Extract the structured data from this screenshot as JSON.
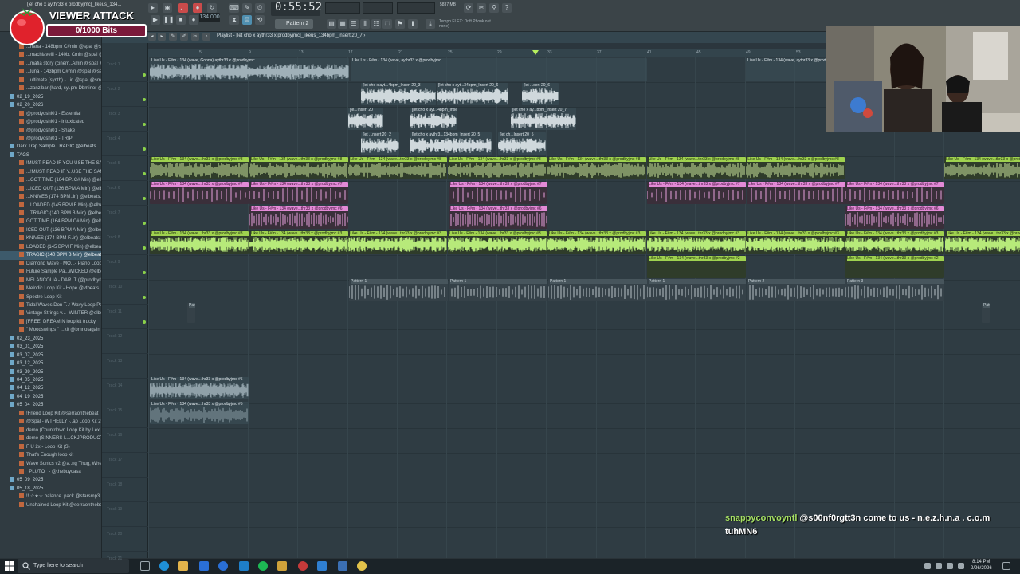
{
  "window": {
    "title": "[let cho x aythr33 x prodbyjmc]_likeus_134..."
  },
  "overlay": {
    "title": "VIEWER ATTACK",
    "bits": "0/1000 Bits"
  },
  "transport": {
    "tempo": "134.000",
    "time": "0:55:52",
    "pattern": "Pattern 2",
    "memory": "5837 MB",
    "hint_line1": "Tempo FLEX: Drift Phonk out",
    "hint_line2": "none)"
  },
  "playlist": {
    "title": "Playlist - [let cho x aythr33 x prodbyjmc]_likeus_134bpm_Insert 20_7 ›",
    "ruler": [
      "5",
      "9",
      "13",
      "17",
      "21",
      "25",
      "29",
      "33",
      "37",
      "41",
      "45",
      "49",
      "53"
    ],
    "tracks": [
      "Track 1",
      "Track 2",
      "Track 3",
      "Track 4",
      "Track 5",
      "Track 6",
      "Track 7",
      "Track 8",
      "Track 9",
      "Track 10",
      "Track 11",
      "Track 12",
      "Track 13",
      "Track 14",
      "Track 15",
      "Track 16",
      "Track 17",
      "Track 18",
      "Track 19",
      "Track 20",
      "Track 21"
    ],
    "clips": {
      "a1": "Like Us - F#m - 134 (wave, Gonna) aythr33 x @prodbyjmc",
      "a1b": "Like Us - F#m - 134 (wave, aythr33 x @prodbyjmc",
      "a1c": "Like Us - F#m - 134 (wave, aythr33 x @prodbyjmc",
      "b1": "[let cho x ayt...4bpm_Insert 20_3",
      "b2": "[let cho x ayt...34bpm_Insert 20_6",
      "b3": "[let ...sert 20_6",
      "c1": "[le...Insert 20",
      "c2": "[let cho x ayt...4bpm_Insert 20_4",
      "c3": "[let cho x ay...bpm_Insert 20_7",
      "d1": "[let ...nsert 20_2",
      "d2": "[let cho x aythr3...134bpm_Insert 20_5",
      "d3": "[let ch...Insert 20_5",
      "green": "Like Us - F#m - 134 (wave...thr33 x @prodbyjmc #8",
      "pink": "Like Us - F#m - 134 (wave...thr33 x @prodbyjmc #7",
      "pink2": "Like Us - F#m - 134 (wave...thr33 x @prodbyjmc #6",
      "green2": "Like Us - F#m - 134 (wave...thr33 x @prodbyjmc #3",
      "green3": "Like Us - F#m - 134 (wave...thr33 x @prodbyjmc #2",
      "pat1": "Pattern 1",
      "pat2": "Pattern 2",
      "pat3": "Pattern 3",
      "low1": "Like Us - F#m - 134 (wave...thr33 x @prodbyjmc #5"
    }
  },
  "browser": {
    "items": [
      {
        "label": "...hana - 148bpm C#min @spal @serra",
        "type": "file"
      },
      {
        "label": "...machiavelli - 140b. Cmin @spal @serra",
        "type": "file"
      },
      {
        "label": "...mafia story (cinem..Amin @spal @smoker",
        "type": "file"
      },
      {
        "label": "...luna - 143bpm C#min @spal @serra",
        "type": "file"
      },
      {
        "label": "...ultimate (synth) - ..in @spal @smoothie",
        "type": "file"
      },
      {
        "label": "...zanzibar (hard, sy..pm Dbminor @spal)",
        "type": "file"
      },
      {
        "label": "02_19_2025",
        "type": "folder"
      },
      {
        "label": "02_20_2026",
        "type": "folder"
      },
      {
        "label": "@prodyoshi01 - Essential",
        "type": "file"
      },
      {
        "label": "@prodyoshi01 - Intoxicated",
        "type": "file"
      },
      {
        "label": "@prodyoshi01 - Shake",
        "type": "file"
      },
      {
        "label": "@prodyoshi01 - TRIP",
        "type": "file"
      },
      {
        "label": "Dark Trap Sample...RAGIC @elbeats",
        "type": "folder"
      },
      {
        "label": "TAGS",
        "type": "folder"
      },
      {
        "label": "!MUST READ IF YOU USE THE SAMPLES!",
        "type": "file"
      },
      {
        "label": "...!MUST READ IF Y..USE THE SAMPLES",
        "type": "file"
      },
      {
        "label": "...GOT TIME (164 BP..C# Min) @elbeats",
        "type": "file"
      },
      {
        "label": "...ICED OUT (136 BPM A Min) @elbeats",
        "type": "file"
      },
      {
        "label": "...KNIVES (174 BPM..in) @elbeats.wav",
        "type": "file"
      },
      {
        "label": "...LOADED (145 BPM F Min) @elbeats",
        "type": "file"
      },
      {
        "label": "...TRAGIC (140 BPM B Min) @elbeats",
        "type": "file"
      },
      {
        "label": "GOT TIME (164 BPM C# Min) @elbeats",
        "type": "file"
      },
      {
        "label": "ICED OUT (136 BPM A Min) @elbeats",
        "type": "file"
      },
      {
        "label": "KNIVES (174 BPM F..in) @elbeats.wav",
        "type": "file"
      },
      {
        "label": "LOADED (145 BPM F Min) @elbeats",
        "type": "file"
      },
      {
        "label": "TRAGIC (140 BPM B Min) @elbeats",
        "type": "selected"
      },
      {
        "label": "Diamond Wave - MO...- Piano Loop Kit",
        "type": "file"
      },
      {
        "label": "Future Sample Pa...WICKED @elbeats",
        "type": "file"
      },
      {
        "label": "MELANCOLIA - DAR..T (@prodbyrlana)",
        "type": "file"
      },
      {
        "label": "Melodic Loop Kit - Hope @vtbeats",
        "type": "file"
      },
      {
        "label": "Spectre Loop Kit",
        "type": "file"
      },
      {
        "label": "Tidal Waves Don T..r Wavy Loop Pack",
        "type": "file"
      },
      {
        "label": "Vintage Strings v...- WINTER @elbeats",
        "type": "file"
      },
      {
        "label": "[FREE] DREAMIN loop kit trucky",
        "type": "file"
      },
      {
        "label": "\" Moodswings \" ...kit @bmnotagain",
        "type": "file"
      },
      {
        "label": "02_23_2025",
        "type": "folder"
      },
      {
        "label": "03_01_2025",
        "type": "folder"
      },
      {
        "label": "03_07_2025",
        "type": "folder"
      },
      {
        "label": "03_12_2025",
        "type": "folder"
      },
      {
        "label": "03_29_2025",
        "type": "folder"
      },
      {
        "label": "04_05_2025",
        "type": "folder"
      },
      {
        "label": "04_12_2025",
        "type": "folder"
      },
      {
        "label": "04_19_2025",
        "type": "folder"
      },
      {
        "label": "05_04_2025",
        "type": "folder"
      },
      {
        "label": "!Friend Loop Kit @serraonthebeat",
        "type": "file"
      },
      {
        "label": "@Spal - WTHELLY -..ap Loop Kit 2025",
        "type": "file"
      },
      {
        "label": "demo (Countdown Loop Kit by Lexus)",
        "type": "file"
      },
      {
        "label": "demo (SINNERS L...CKJPRODUCTION)",
        "type": "file"
      },
      {
        "label": "F U 2x - Loop Kit (S)",
        "type": "file"
      },
      {
        "label": "That's Enough loop kit",
        "type": "file"
      },
      {
        "label": "Wave Sonics v2 @a..ng Thug, Wheezy",
        "type": "file"
      },
      {
        "label": "_PLUTO_ - @thebuycasa",
        "type": "file"
      },
      {
        "label": "05_09_2025",
        "type": "folder"
      },
      {
        "label": "05_18_2025",
        "type": "folder"
      },
      {
        "label": "!! ☆★☆ balance..pack @starsmp3",
        "type": "file"
      },
      {
        "label": "Unchained Loop Kit @serraonthebeat",
        "type": "file"
      }
    ]
  },
  "chat": {
    "user": "snappyconvoyntl",
    "message": "@s00nf0rgtt3n come to us - n.e.z.h.n.a . c.o.m tuhMN6"
  },
  "taskbar": {
    "search_placeholder": "Type here to search",
    "time": "8:14 PM",
    "date": "2/26/2026"
  },
  "colors": {
    "accent_green": "#9fd24f",
    "accent_pink": "#e38ad7",
    "overlay_bar": "#7b1a3b"
  }
}
